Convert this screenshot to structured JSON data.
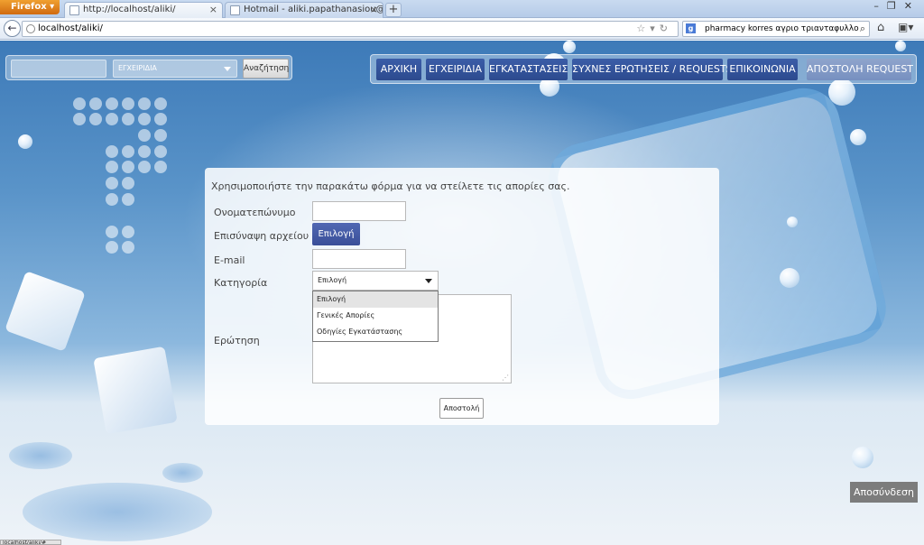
{
  "browser": {
    "app_button": "Firefox",
    "tabs": [
      {
        "title": "http://localhost/aliki/",
        "active": true
      },
      {
        "title": "Hotmail - aliki.papathanasiou@hotm...",
        "active": false
      }
    ],
    "new_tab_label": "+",
    "address": "localhost/aliki/",
    "search_query": "pharmacy korres αγριο τριανταφυλλο",
    "status_url": "localhost/aliki/#"
  },
  "site_search": {
    "select_value": "ΕΓΧΕΙΡΙΔΙΑ",
    "button_label": "Αναζήτηση"
  },
  "nav": {
    "items": [
      {
        "label": "ΑΡΧΙΚΗ"
      },
      {
        "label": "ΕΓΧΕΙΡΙΔΙΑ"
      },
      {
        "label": "ΕΓΚΑΤΑΣΤΑΣΕΙΣ"
      },
      {
        "label": "ΣΥΧΝΕΣ ΕΡΩΤΗΣΕΙΣ / REQUESTS"
      },
      {
        "label": "ΕΠΙΚΟΙΝΩΝΙΑ"
      },
      {
        "label": "ΑΠΟΣΤΟΛΗ REQUEST"
      }
    ]
  },
  "form": {
    "intro": "Χρησιμοποιήστε την παρακάτω φόρμα για να στείλετε τις απορίες σας.",
    "name_label": "Ονοματεπώνυμο",
    "file_label": "Επισύναψη αρχείου",
    "file_button": "Επιλογή",
    "email_label": "E-mail",
    "category_label": "Κατηγορία",
    "category_value": "Επιλογή",
    "category_options": [
      "Επιλογή",
      "Γενικές Απορίες",
      "Οδηγίες Εγκατάστασης"
    ],
    "question_label": "Ερώτηση",
    "submit": "Αποστολή"
  },
  "logout": "Αποσύνδεση"
}
